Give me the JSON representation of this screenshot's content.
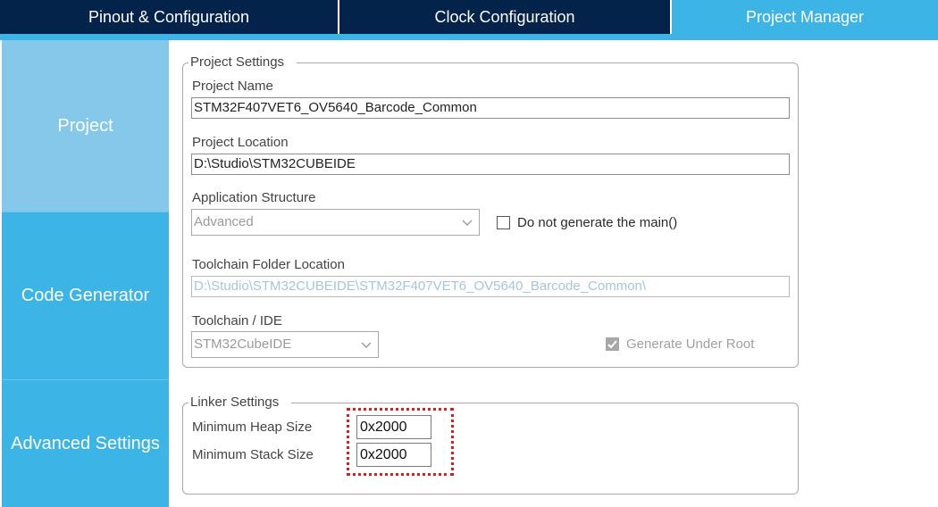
{
  "tabs": [
    {
      "label": "Pinout & Configuration",
      "active": false
    },
    {
      "label": "Clock Configuration",
      "active": false
    },
    {
      "label": "Project Manager",
      "active": true
    }
  ],
  "sidebar": {
    "items": [
      {
        "label": "Project"
      },
      {
        "label": "Code Generator"
      },
      {
        "label": "Advanced Settings"
      }
    ]
  },
  "project_settings": {
    "title": "Project Settings",
    "project_name_label": "Project Name",
    "project_name_value": "STM32F407VET6_OV5640_Barcode_Common",
    "project_location_label": "Project Location",
    "project_location_value": "D:\\Studio\\STM32CUBEIDE",
    "app_structure_label": "Application Structure",
    "app_structure_value": "Advanced",
    "no_main_label": "Do not generate the main()",
    "no_main_checked": false,
    "toolchain_folder_label": "Toolchain Folder Location",
    "toolchain_folder_value": "D:\\Studio\\STM32CUBEIDE\\STM32F407VET6_OV5640_Barcode_Common\\",
    "toolchain_ide_label": "Toolchain / IDE",
    "toolchain_ide_value": "STM32CubeIDE",
    "generate_under_root_label": "Generate Under Root",
    "generate_under_root_checked": true
  },
  "linker_settings": {
    "title": "Linker Settings",
    "heap_label": "Minimum Heap Size",
    "heap_value": "0x2000",
    "stack_label": "Minimum Stack Size",
    "stack_value": "0x2000"
  },
  "colors": {
    "tab_dark": "#03234b",
    "tab_active": "#3cb4e6",
    "nav_selected": "#85c8ea",
    "highlight": "#d42020"
  }
}
